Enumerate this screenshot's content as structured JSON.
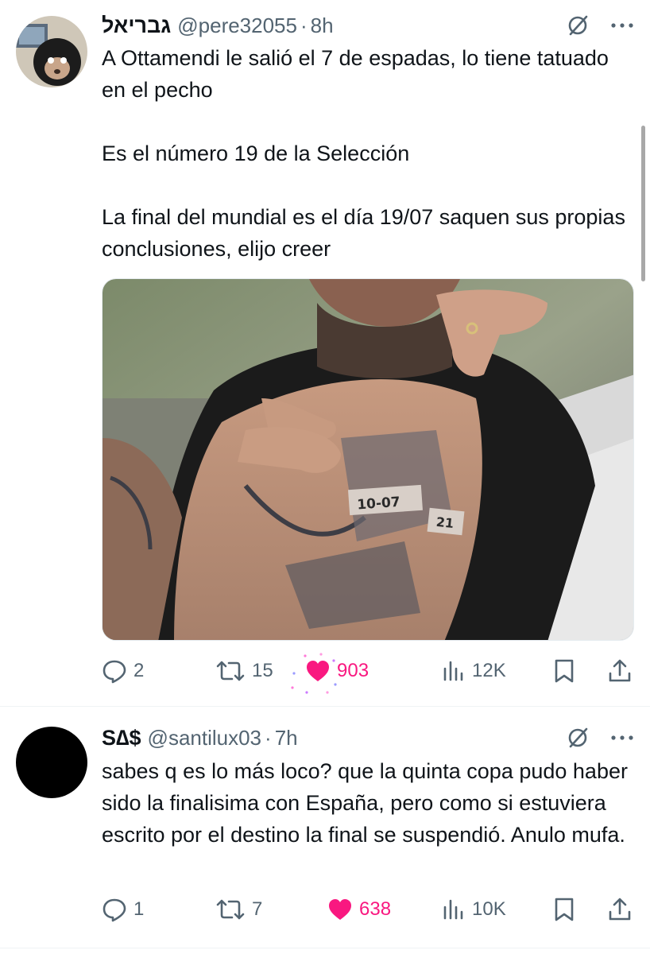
{
  "tweets": [
    {
      "name": "גבריאל",
      "handle": "@pere32055",
      "time": "8h",
      "text": "A Ottamendi le salió el 7 de espadas, lo tiene tatuado en el pecho\n\nEs el número 19 de la Selección\n\nLa final del mundial es el día 19/07 saquen sus propias conclusiones, elijo creer",
      "media_tattoo_text": {
        "date": "10-07",
        "number": "21"
      },
      "stats": {
        "replies": "2",
        "retweets": "15",
        "likes": "903",
        "views": "12K"
      }
    },
    {
      "name": "S∆$",
      "handle": "@santilux03",
      "time": "7h",
      "text": "sabes q es lo más loco? que la quinta copa pudo haber sido la finalisima con España, pero como si estuviera escrito por el destino la final se suspendió. Anulo mufa.",
      "stats": {
        "replies": "1",
        "retweets": "7",
        "likes": "638",
        "views": "10K"
      }
    }
  ],
  "icons": {
    "reply": "reply-icon",
    "retweet": "retweet-icon",
    "like": "heart-icon",
    "views": "views-icon",
    "bookmark": "bookmark-icon",
    "share": "share-icon",
    "grok": "grok-icon",
    "more": "more-icon"
  },
  "colors": {
    "like": "#f91880",
    "secondary_text": "#536471",
    "primary_text": "#0f1419"
  }
}
